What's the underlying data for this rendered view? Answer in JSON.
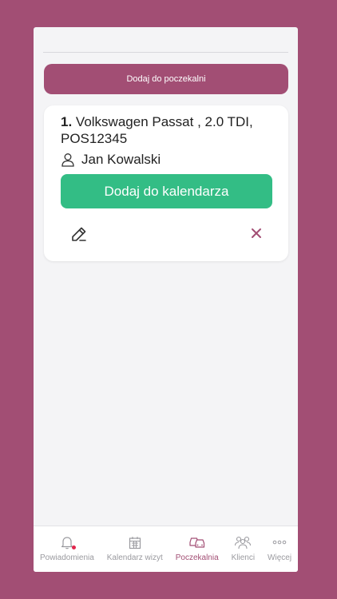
{
  "header": {
    "add_waiting_label": "Dodaj do poczekalni"
  },
  "card": {
    "number": "1.",
    "vehicle": "Volkswagen Passat , 2.0 TDI, POS12345",
    "client": "Jan Kowalski",
    "calendar_button_label": "Dodaj do kalendarza"
  },
  "nav": {
    "items": [
      {
        "label": "Powiadomienia",
        "icon": "bell-icon"
      },
      {
        "label": "Kalendarz wizyt",
        "icon": "calendar-icon"
      },
      {
        "label": "Poczekalnia",
        "icon": "cars-icon"
      },
      {
        "label": "Klienci",
        "icon": "people-icon"
      },
      {
        "label": "Więcej",
        "icon": "more-icon"
      }
    ],
    "active_index": 2
  },
  "colors": {
    "brand": "#a24e74",
    "accent_green": "#33bd85",
    "notification_dot": "#e2264d"
  }
}
